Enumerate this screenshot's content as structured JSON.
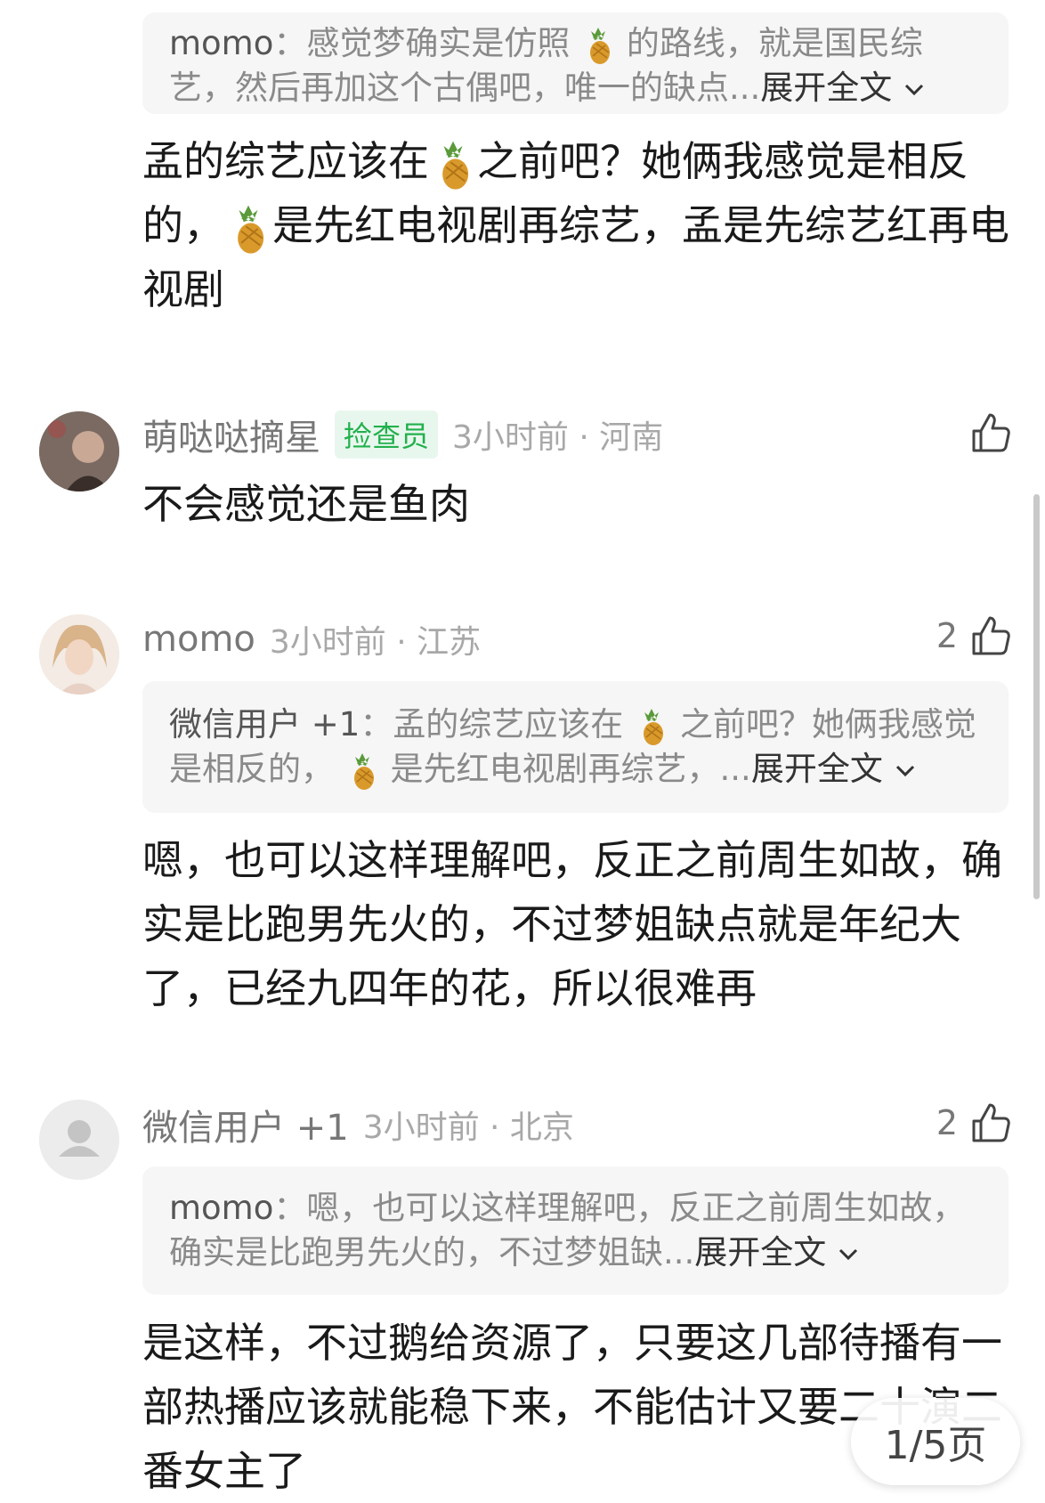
{
  "comments": [
    {
      "quote": {
        "author": "momo",
        "sep": "：",
        "t1": "感觉梦确实是仿照",
        "t2": "的路线，就是国民综艺，然后再加这个古偶吧，唯一的缺点...",
        "expand": "展开全文"
      },
      "body": {
        "p1": "孟的综艺应该在",
        "p2": "之前吧？她俩我感觉是相反的，",
        "p3": "是先红电视剧再综艺，孟是先综艺红再电视剧"
      }
    },
    {
      "name": "萌哒哒摘星",
      "badge": "捡查员",
      "meta": "3小时前 · 河南",
      "likes": "",
      "body": "不会感觉还是鱼肉"
    },
    {
      "name": "momo",
      "meta": "3小时前 · 江苏",
      "likes": "2",
      "quote": {
        "author": "微信用户 +1",
        "sep": "：",
        "t1": "孟的综艺应该在",
        "t2": "之前吧？她俩我感觉是相反的，",
        "t3": "是先红电视剧再综艺，...",
        "expand": "展开全文"
      },
      "body": "嗯，也可以这样理解吧，反正之前周生如故，确实是比跑男先火的，不过梦姐缺点就是年纪大了，已经九四年的花，所以很难再"
    },
    {
      "name": "微信用户 +1",
      "meta": "3小时前 · 北京",
      "likes": "2",
      "quote": {
        "author": "momo",
        "sep": "：",
        "t1": "嗯，也可以这样理解吧，反正之前周生如故，确实是比跑男先火的，不过梦姐缺...",
        "expand": "展开全文"
      },
      "body": "是这样，不过鹅给资源了，只要这几部待播有一部热播应该就能稳下来，不能估计又要二十演二番女主了"
    }
  ],
  "page_indicator": "1/5页",
  "icons": {
    "like": "thumbs-up-icon",
    "pineapple": "pineapple-emoji",
    "expand": "chevron-down-icon",
    "default_avatar": "user-silhouette-icon"
  }
}
